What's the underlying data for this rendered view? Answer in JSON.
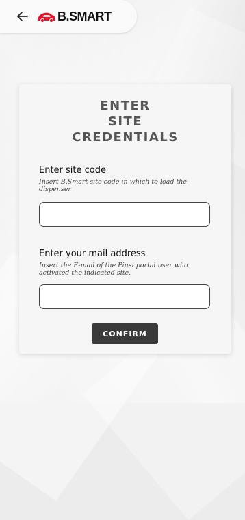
{
  "header": {
    "back_icon": "arrow-left-icon",
    "logo_text": "B.SMART",
    "logo_color": "#e3132b"
  },
  "card": {
    "title_lines": [
      "ENTER",
      "SITE",
      "CREDENTIALS"
    ],
    "site_code": {
      "label": "Enter site code",
      "hint": "Insert B.Smart site code in which to load the dispenser",
      "value": ""
    },
    "mail": {
      "label": "Enter your mail address",
      "hint": "Insert the E-mail of the Piusi portal user who activated the indicated site.",
      "value": ""
    },
    "confirm_label": "CONFIRM"
  },
  "colors": {
    "button_bg": "#3a3a3a",
    "title_text": "#555555"
  }
}
